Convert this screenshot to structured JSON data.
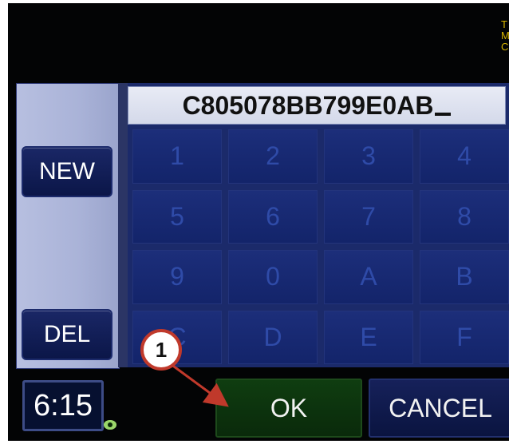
{
  "side_label": [
    "T",
    "M",
    "C"
  ],
  "left_panel": {
    "new_label": "NEW",
    "del_label": "DEL"
  },
  "code_field": {
    "value": "C805078BB799E0AB"
  },
  "keypad": {
    "keys": [
      "1",
      "2",
      "3",
      "4",
      "5",
      "6",
      "7",
      "8",
      "9",
      "0",
      "A",
      "B",
      "C",
      "D",
      "E",
      "F"
    ]
  },
  "bottom_bar": {
    "clock": "6:15",
    "ok_label": "OK",
    "cancel_label": "CANCEL"
  },
  "callout": {
    "number": "1"
  },
  "colors": {
    "accent_green": "#0f3d10",
    "panel_blue": "#1b2a6a",
    "callout_red": "#c0392b",
    "side_text_yellow": "#d6b400"
  },
  "icons": {
    "status": "status-dot-icon",
    "cursor": "text-cursor-icon",
    "callout_arrow": "arrow-icon"
  }
}
